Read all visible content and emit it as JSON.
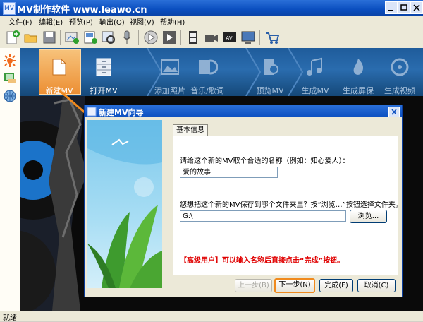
{
  "window": {
    "icon": "mv-app-icon",
    "icon_text": "MV",
    "title": "MV制作软件 www.leawo.cn",
    "controls": [
      "minimize",
      "maximize",
      "close"
    ]
  },
  "menu": [
    "文件(F)",
    "编辑(E)",
    "预览(P)",
    "输出(O)",
    "视图(V)",
    "帮助(H)"
  ],
  "toolbar": [
    "new-icon",
    "open-icon",
    "save-icon",
    "add-image-icon",
    "add-photo-icon",
    "photo-preview-icon",
    "mic-icon",
    "play-icon",
    "play-forward-icon",
    "film-icon",
    "video-camera-icon",
    "avi-icon",
    "screen-icon",
    "cart-icon"
  ],
  "toolbar_avi_text": "AVI",
  "nav": {
    "items": [
      {
        "label": "新建MV",
        "active": true
      },
      {
        "label": "打开MV",
        "active": false
      },
      {
        "label": "添加照片",
        "active": false
      },
      {
        "label": "音乐/歌词",
        "active": false
      },
      {
        "label": "预览MV",
        "active": false
      },
      {
        "label": "生成MV",
        "active": false
      },
      {
        "label": "生成屏保",
        "active": false
      },
      {
        "label": "生成视频",
        "active": false
      }
    ]
  },
  "status": "就绪",
  "dialog": {
    "title": "新建MV向导",
    "tab": "基本信息",
    "name_prompt": "请给这个新的MV取个合适的名称（例如：知心爱人）：",
    "name_value": "爱的故事",
    "folder_prompt": "您想把这个新的MV保存到哪个文件夹里？按“浏览…”按钮选择文件夹。",
    "folder_value": "G:\\",
    "browse_label": "浏览...",
    "tip": "【高级用户】可以输入名称后直接点击“完成”按钮。",
    "buttons": {
      "prev": "上一步(B)",
      "next": "下一步(N)",
      "finish": "完成(F)",
      "cancel": "取消(C)"
    }
  },
  "colors": {
    "titlebar": "#0b4fc0",
    "accent_orange": "#f08a1e",
    "tip_red": "#e00000",
    "banner_blue": "#2a6cae"
  }
}
